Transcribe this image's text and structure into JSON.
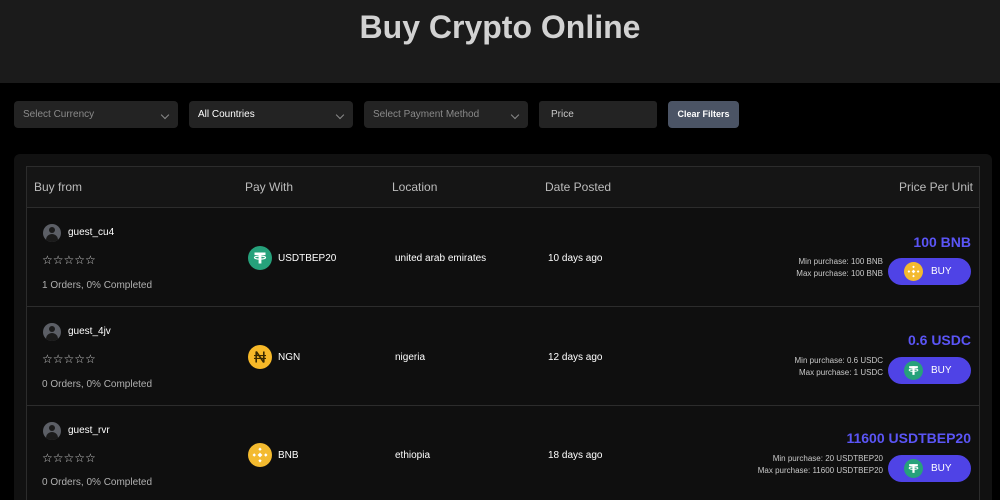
{
  "header": {
    "title": "Buy Crypto Online"
  },
  "filters": {
    "currency_placeholder": "Select Currency",
    "country_value": "All Countries",
    "payment_placeholder": "Select Payment Method",
    "price_placeholder": "Price",
    "clear_label": "Clear Filters"
  },
  "table": {
    "columns": [
      "Buy from",
      "Pay With",
      "Location",
      "Date Posted",
      "Price Per Unit"
    ],
    "rows": [
      {
        "username": "guest_cu4",
        "stars": "☆☆☆☆☆",
        "orders": "1 Orders, 0% Completed",
        "pay_with": "USDTBEP20",
        "pay_icon": "tether-icon",
        "location": "united arab emirates",
        "date": "10 days ago",
        "price": "100 BNB",
        "min": "Min purchase: 100 BNB",
        "max": "Max purchase: 100 BNB",
        "buy_label": "BUY",
        "buy_icon": "bnb-icon"
      },
      {
        "username": "guest_4jv",
        "stars": "☆☆☆☆☆",
        "orders": "0 Orders, 0% Completed",
        "pay_with": "NGN",
        "pay_icon": "naira-icon",
        "location": "nigeria",
        "date": "12 days ago",
        "price": "0.6 USDC",
        "min": "Min purchase: 0.6 USDC",
        "max": "Max purchase: 1 USDC",
        "buy_label": "BUY",
        "buy_icon": "tether-icon"
      },
      {
        "username": "guest_rvr",
        "stars": "☆☆☆☆☆",
        "orders": "0 Orders, 0% Completed",
        "pay_with": "BNB",
        "pay_icon": "bnb-icon",
        "location": "ethiopia",
        "date": "18 days ago",
        "price": "11600 USDTBEP20",
        "min": "Min purchase: 20 USDTBEP20",
        "max": "Max purchase: 11600 USDTBEP20",
        "buy_label": "BUY",
        "buy_icon": "tether-icon"
      }
    ]
  },
  "colors": {
    "accent": "#5b55f6",
    "buy_button": "#4f43e6",
    "tether": "#26a17b",
    "bnb": "#f3ba2f",
    "naira": "#f7b928"
  }
}
